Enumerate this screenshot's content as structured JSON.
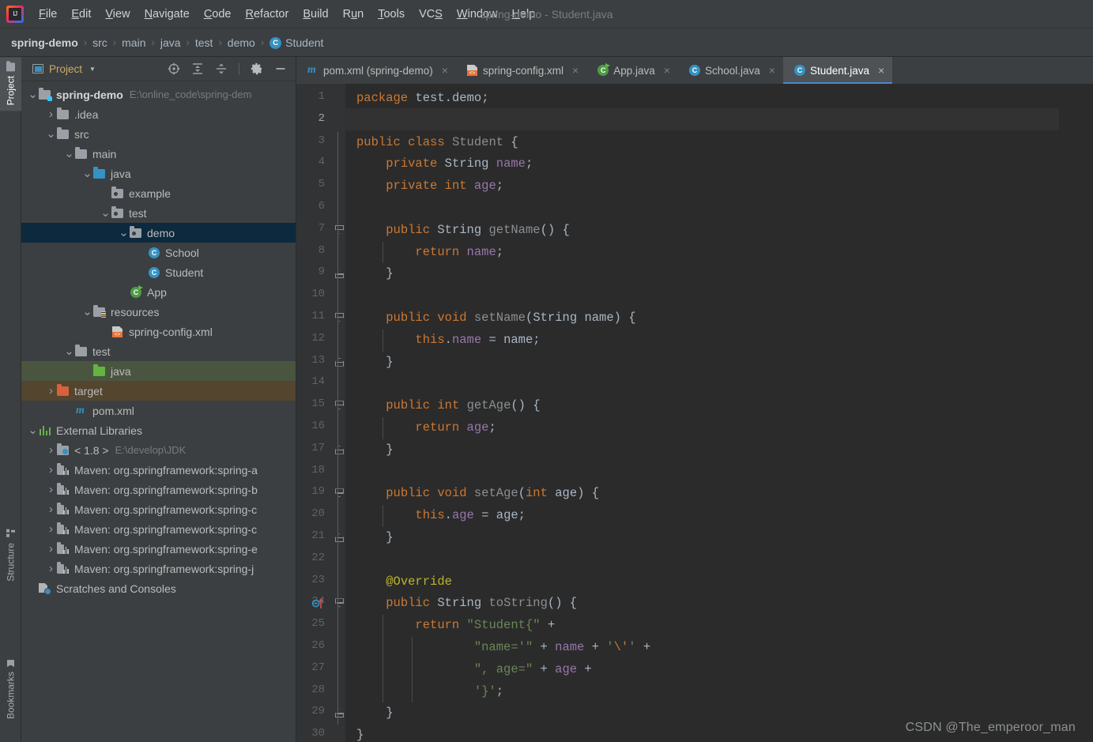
{
  "window": {
    "title": "spring-demo - Student.java"
  },
  "menu": {
    "items": [
      {
        "label": "File",
        "mnemonic": "F"
      },
      {
        "label": "Edit",
        "mnemonic": "E"
      },
      {
        "label": "View",
        "mnemonic": "V"
      },
      {
        "label": "Navigate",
        "mnemonic": "N"
      },
      {
        "label": "Code",
        "mnemonic": "C"
      },
      {
        "label": "Refactor",
        "mnemonic": "R"
      },
      {
        "label": "Build",
        "mnemonic": "B"
      },
      {
        "label": "Run",
        "mnemonic": "u"
      },
      {
        "label": "Tools",
        "mnemonic": "T"
      },
      {
        "label": "VCS",
        "mnemonic": "S"
      },
      {
        "label": "Window",
        "mnemonic": "W"
      },
      {
        "label": "Help",
        "mnemonic": "H"
      }
    ]
  },
  "breadcrumb": {
    "items": [
      "spring-demo",
      "src",
      "main",
      "java",
      "test",
      "demo",
      "Student"
    ],
    "separator": "›",
    "last_icon": "java-class-icon"
  },
  "toolwindow_strip": {
    "left_top": [
      {
        "label": "Project",
        "icon": "folder-icon",
        "active": true
      }
    ],
    "left_bottom": [
      {
        "label": "Structure",
        "icon": "structure-icon",
        "active": false
      },
      {
        "label": "Bookmarks",
        "icon": "bookmark-icon",
        "active": false
      }
    ]
  },
  "project_panel": {
    "title": "Project",
    "dropdown_caret": "▼",
    "toolbar": [
      {
        "name": "select-opened-file-icon",
        "tooltip": "Select Opened File"
      },
      {
        "name": "expand-all-icon",
        "tooltip": "Expand All"
      },
      {
        "name": "collapse-all-icon",
        "tooltip": "Collapse All"
      },
      {
        "name": "settings-gear-icon",
        "tooltip": "Settings"
      },
      {
        "name": "hide-icon",
        "tooltip": "Hide"
      }
    ],
    "tree": [
      {
        "label": "spring-demo",
        "sub": "E:\\online_code\\spring-dem",
        "indent": 0,
        "arrow": "down",
        "icon": "module-folder",
        "bold": true,
        "state": "normal"
      },
      {
        "label": ".idea",
        "sub": "",
        "indent": 1,
        "arrow": "right",
        "icon": "folder-grey",
        "bold": false,
        "state": "normal"
      },
      {
        "label": "src",
        "sub": "",
        "indent": 1,
        "arrow": "down",
        "icon": "folder-grey",
        "bold": false,
        "state": "normal"
      },
      {
        "label": "main",
        "sub": "",
        "indent": 2,
        "arrow": "down",
        "icon": "folder-grey",
        "bold": false,
        "state": "normal"
      },
      {
        "label": "java",
        "sub": "",
        "indent": 3,
        "arrow": "down",
        "icon": "folder-source-blue",
        "bold": false,
        "state": "normal"
      },
      {
        "label": "example",
        "sub": "",
        "indent": 4,
        "arrow": "none",
        "icon": "package-grey",
        "bold": false,
        "state": "normal"
      },
      {
        "label": "test",
        "sub": "",
        "indent": 4,
        "arrow": "down",
        "icon": "package-grey",
        "bold": false,
        "state": "normal"
      },
      {
        "label": "demo",
        "sub": "",
        "indent": 5,
        "arrow": "down",
        "icon": "package-grey",
        "bold": false,
        "state": "selected"
      },
      {
        "label": "School",
        "sub": "",
        "indent": 6,
        "arrow": "none",
        "icon": "java-class",
        "bold": false,
        "state": "normal"
      },
      {
        "label": "Student",
        "sub": "",
        "indent": 6,
        "arrow": "none",
        "icon": "java-class",
        "bold": false,
        "state": "normal"
      },
      {
        "label": "App",
        "sub": "",
        "indent": 5,
        "arrow": "none",
        "icon": "java-class-runnable",
        "bold": false,
        "state": "normal"
      },
      {
        "label": "resources",
        "sub": "",
        "indent": 3,
        "arrow": "down",
        "icon": "folder-resources",
        "bold": false,
        "state": "normal"
      },
      {
        "label": "spring-config.xml",
        "sub": "",
        "indent": 4,
        "arrow": "none",
        "icon": "xml-file",
        "bold": false,
        "state": "normal"
      },
      {
        "label": "test",
        "sub": "",
        "indent": 2,
        "arrow": "down",
        "icon": "folder-grey",
        "bold": false,
        "state": "normal"
      },
      {
        "label": "java",
        "sub": "",
        "indent": 3,
        "arrow": "none",
        "icon": "folder-test-green",
        "bold": false,
        "state": "test-source"
      },
      {
        "label": "target",
        "sub": "",
        "indent": 1,
        "arrow": "right",
        "icon": "folder-excluded-orange",
        "bold": false,
        "state": "excluded"
      },
      {
        "label": "pom.xml",
        "sub": "",
        "indent": 2,
        "arrow": "none",
        "icon": "maven-file",
        "bold": false,
        "state": "normal"
      },
      {
        "label": "External Libraries",
        "sub": "",
        "indent": 0,
        "arrow": "down",
        "icon": "libraries",
        "bold": false,
        "state": "normal"
      },
      {
        "label": "< 1.8 >",
        "sub": "E:\\develop\\JDK",
        "indent": 1,
        "arrow": "right",
        "icon": "jdk",
        "bold": false,
        "state": "normal"
      },
      {
        "label": "Maven: org.springframework:spring-a",
        "sub": "",
        "indent": 1,
        "arrow": "right",
        "icon": "jar",
        "bold": false,
        "state": "normal"
      },
      {
        "label": "Maven: org.springframework:spring-b",
        "sub": "",
        "indent": 1,
        "arrow": "right",
        "icon": "jar",
        "bold": false,
        "state": "normal"
      },
      {
        "label": "Maven: org.springframework:spring-c",
        "sub": "",
        "indent": 1,
        "arrow": "right",
        "icon": "jar",
        "bold": false,
        "state": "normal"
      },
      {
        "label": "Maven: org.springframework:spring-c",
        "sub": "",
        "indent": 1,
        "arrow": "right",
        "icon": "jar",
        "bold": false,
        "state": "normal"
      },
      {
        "label": "Maven: org.springframework:spring-e",
        "sub": "",
        "indent": 1,
        "arrow": "right",
        "icon": "jar",
        "bold": false,
        "state": "normal"
      },
      {
        "label": "Maven: org.springframework:spring-j",
        "sub": "",
        "indent": 1,
        "arrow": "right",
        "icon": "jar",
        "bold": false,
        "state": "normal"
      },
      {
        "label": "Scratches and Consoles",
        "sub": "",
        "indent": 0,
        "arrow": "none",
        "icon": "scratches",
        "bold": false,
        "state": "normal"
      }
    ]
  },
  "editor_tabs": [
    {
      "label": "pom.xml (spring-demo)",
      "icon": "maven-file",
      "active": false,
      "close": "×"
    },
    {
      "label": "spring-config.xml",
      "icon": "xml-file",
      "active": false,
      "close": "×"
    },
    {
      "label": "App.java",
      "icon": "java-class-runnable",
      "active": false,
      "close": "×"
    },
    {
      "label": "School.java",
      "icon": "java-class",
      "active": false,
      "close": "×"
    },
    {
      "label": "Student.java",
      "icon": "java-class",
      "active": true,
      "close": "×"
    }
  ],
  "editor": {
    "file": "Student.java",
    "caret_line": 2,
    "total_lines": 30,
    "gutter_icons": [
      {
        "line": 24,
        "name": "overridden-method-icon"
      }
    ],
    "fold_regions": [
      {
        "start": 7,
        "end": 9
      },
      {
        "start": 11,
        "end": 13
      },
      {
        "start": 15,
        "end": 17
      },
      {
        "start": 19,
        "end": 21
      },
      {
        "start": 24,
        "end": 29
      }
    ],
    "lines": [
      {
        "n": 1,
        "text": "package test.demo;"
      },
      {
        "n": 2,
        "text": ""
      },
      {
        "n": 3,
        "text": "public class Student {"
      },
      {
        "n": 4,
        "text": "    private String name;"
      },
      {
        "n": 5,
        "text": "    private int age;"
      },
      {
        "n": 6,
        "text": ""
      },
      {
        "n": 7,
        "text": "    public String getName() {"
      },
      {
        "n": 8,
        "text": "        return name;"
      },
      {
        "n": 9,
        "text": "    }"
      },
      {
        "n": 10,
        "text": ""
      },
      {
        "n": 11,
        "text": "    public void setName(String name) {"
      },
      {
        "n": 12,
        "text": "        this.name = name;"
      },
      {
        "n": 13,
        "text": "    }"
      },
      {
        "n": 14,
        "text": ""
      },
      {
        "n": 15,
        "text": "    public int getAge() {"
      },
      {
        "n": 16,
        "text": "        return age;"
      },
      {
        "n": 17,
        "text": "    }"
      },
      {
        "n": 18,
        "text": ""
      },
      {
        "n": 19,
        "text": "    public void setAge(int age) {"
      },
      {
        "n": 20,
        "text": "        this.age = age;"
      },
      {
        "n": 21,
        "text": "    }"
      },
      {
        "n": 22,
        "text": ""
      },
      {
        "n": 23,
        "text": "    @Override"
      },
      {
        "n": 24,
        "text": "    public String toString() {"
      },
      {
        "n": 25,
        "text": "        return \"Student{\" +"
      },
      {
        "n": 26,
        "text": "                \"name='\" + name + '\\'' +"
      },
      {
        "n": 27,
        "text": "                \", age=\" + age +"
      },
      {
        "n": 28,
        "text": "                '}';"
      },
      {
        "n": 29,
        "text": "    }"
      },
      {
        "n": 30,
        "text": "}"
      }
    ]
  },
  "watermark": {
    "text": "CSDN @The_emperoor_man"
  },
  "colors": {
    "background": "#3c3f41",
    "editor_background": "#2b2b2b",
    "gutter_background": "#313335",
    "selection": "#0d293e",
    "test_source_row": "#4a5540",
    "excluded_row": "#54452f",
    "accent_blue": "#3592c4",
    "tab_active_underline": "#4a88c7",
    "keyword": "#cc7832",
    "string": "#6a8759",
    "field": "#9876aa",
    "annotation": "#bbb529",
    "text": "#a9b7c6"
  }
}
